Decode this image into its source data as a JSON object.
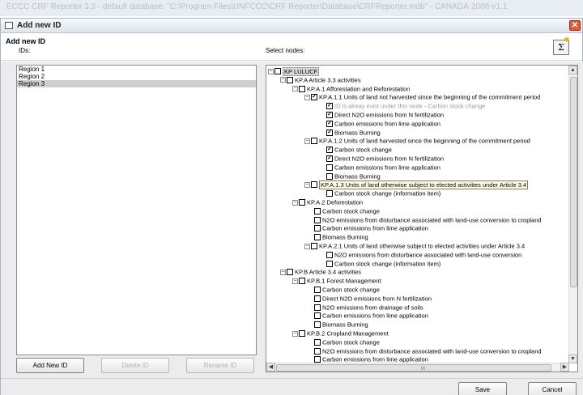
{
  "background_title": "ECCC CRF Reporter 3.3 - default database: \"C:\\Program Files\\UNFCCC\\CRF Reporter\\Database\\CRFReporter.mdb\" - CANADA-2008-v1.1",
  "dialog": {
    "title": "Add new ID",
    "close_icon": "close-icon"
  },
  "header": {
    "title": "Add new ID",
    "ids_label": "IDs:",
    "select_nodes_label": "Select nodes:",
    "sigma_icon": "sigma-icon",
    "sigma_glyph": "Σ",
    "star_glyph": "✱"
  },
  "ids": [
    "Region 1",
    "Region 2",
    "Region 3"
  ],
  "selected_id_index": 2,
  "tree": [
    {
      "level": 0,
      "expander": "−",
      "checked": false,
      "label": "KP LULUCF",
      "style": "selected-node"
    },
    {
      "level": 1,
      "expander": "−",
      "checked": false,
      "label": "KP.A Article 3.3 activities",
      "style": ""
    },
    {
      "level": 2,
      "expander": "−",
      "checked": false,
      "label": "KP.A.1 Afforestation and Reforestation",
      "style": ""
    },
    {
      "level": 3,
      "expander": "−",
      "checked": true,
      "label": "KP.A.1.1 Units of land not harvested since the beginning of the commitment period",
      "style": ""
    },
    {
      "level": 4,
      "expander": "",
      "checked": true,
      "label": "ID is alreay exist under this node - Carbon stock change",
      "style": "grey"
    },
    {
      "level": 4,
      "expander": "",
      "checked": true,
      "label": "Direct N2O emissions from N fertilization",
      "style": ""
    },
    {
      "level": 4,
      "expander": "",
      "checked": true,
      "label": "Carbon emissions from lime application",
      "style": ""
    },
    {
      "level": 4,
      "expander": "",
      "checked": true,
      "label": "Biomass Burning",
      "style": ""
    },
    {
      "level": 3,
      "expander": "−",
      "checked": false,
      "label": "KP.A.1.2 Units of land harvested since the beginning of the commitment period",
      "style": ""
    },
    {
      "level": 4,
      "expander": "",
      "checked": true,
      "label": "Carbon stock change",
      "style": ""
    },
    {
      "level": 4,
      "expander": "",
      "checked": true,
      "label": "Direct N2O emissions from N fertilization",
      "style": ""
    },
    {
      "level": 4,
      "expander": "",
      "checked": false,
      "label": "Carbon emissions from lime application",
      "style": ""
    },
    {
      "level": 4,
      "expander": "",
      "checked": false,
      "label": "Biomass Burning",
      "style": ""
    },
    {
      "level": 3,
      "expander": "−",
      "checked": false,
      "label": "KP.A.1.3 Units of land otherwise subject to elected activities under Article 3.4",
      "style": "tooltip"
    },
    {
      "level": 4,
      "expander": "",
      "checked": false,
      "label": "Carbon stock change (information item)",
      "style": ""
    },
    {
      "level": 2,
      "expander": "−",
      "checked": false,
      "label": "KP.A.2 Deforestation",
      "style": ""
    },
    {
      "level": 3,
      "expander": "",
      "checked": false,
      "label": "Carbon stock change",
      "style": ""
    },
    {
      "level": 3,
      "expander": "",
      "checked": false,
      "label": "N2O emissions from disturbance associated with land-use conversion to cropland",
      "style": ""
    },
    {
      "level": 3,
      "expander": "",
      "checked": false,
      "label": "Carbon emissions from lime application",
      "style": ""
    },
    {
      "level": 3,
      "expander": "",
      "checked": false,
      "label": "Biomass Burning",
      "style": ""
    },
    {
      "level": 3,
      "expander": "−",
      "checked": false,
      "label": "KP.A.2.1 Units of land otherwise subject to elected activities under Article 3.4",
      "style": ""
    },
    {
      "level": 4,
      "expander": "",
      "checked": false,
      "label": "N2O emissions from disturbance associated with land-use conversion",
      "style": ""
    },
    {
      "level": 4,
      "expander": "",
      "checked": false,
      "label": "Carbon stock change (information item)",
      "style": ""
    },
    {
      "level": 1,
      "expander": "−",
      "checked": false,
      "label": "KP.B Article 3.4 activities",
      "style": ""
    },
    {
      "level": 2,
      "expander": "−",
      "checked": false,
      "label": "KP.B.1 Forest Management",
      "style": ""
    },
    {
      "level": 3,
      "expander": "",
      "checked": false,
      "label": "Carbon stock change",
      "style": ""
    },
    {
      "level": 3,
      "expander": "",
      "checked": false,
      "label": "Direct N2O emissions from N fertilization",
      "style": ""
    },
    {
      "level": 3,
      "expander": "",
      "checked": false,
      "label": "N2O emissions from drainage of soils",
      "style": ""
    },
    {
      "level": 3,
      "expander": "",
      "checked": false,
      "label": "Carbon emissions from lime application",
      "style": ""
    },
    {
      "level": 3,
      "expander": "",
      "checked": false,
      "label": "Biomass Burning",
      "style": ""
    },
    {
      "level": 2,
      "expander": "−",
      "checked": false,
      "label": "KP.B.2 Cropland Management",
      "style": ""
    },
    {
      "level": 3,
      "expander": "",
      "checked": false,
      "label": "Carbon stock change",
      "style": ""
    },
    {
      "level": 3,
      "expander": "",
      "checked": false,
      "label": "N2O emissions from disturbance associated with land-use conversion to cropland",
      "style": ""
    },
    {
      "level": 3,
      "expander": "",
      "checked": false,
      "label": "Carbon emissions from lime application",
      "style": ""
    }
  ],
  "scrollbars": {
    "up": "▲",
    "down": "▼",
    "left": "◀",
    "right": "▶",
    "grip": "III"
  },
  "buttons": {
    "add_new_id": "Add New ID",
    "delete_id": "Delete ID",
    "rename_id": "Rename ID",
    "save": "Save",
    "cancel": "Cancel"
  },
  "colors": {
    "close_button": "#e05a3a",
    "tooltip_bg": "#fffde1",
    "selection": "#cfcfcf"
  }
}
